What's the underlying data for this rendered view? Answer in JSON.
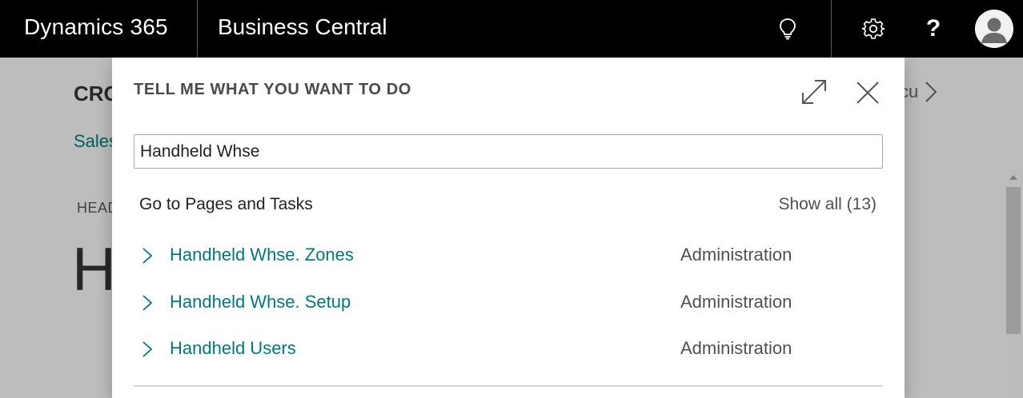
{
  "topbar": {
    "brand": "Dynamics 365",
    "app": "Business Central",
    "icons": [
      "lightbulb-icon",
      "gear-icon",
      "help-icon",
      "avatar"
    ],
    "help_glyph": "?"
  },
  "background_page": {
    "title": "CRO",
    "link": "Sales",
    "heading": "HEAD",
    "big_text": "H",
    "right_fragment": "cu"
  },
  "dialog": {
    "title": "TELL ME WHAT YOU WANT TO DO",
    "search_value": "Handheld Whse",
    "section_title": "Go to Pages and Tasks",
    "show_all": "Show all (13)",
    "results": [
      {
        "label": "Handheld Whse. Zones",
        "category": "Administration"
      },
      {
        "label": "Handheld Whse. Setup",
        "category": "Administration"
      },
      {
        "label": "Handheld Users",
        "category": "Administration"
      }
    ]
  },
  "colors": {
    "accent": "#00797a",
    "topbar": "#000000"
  }
}
